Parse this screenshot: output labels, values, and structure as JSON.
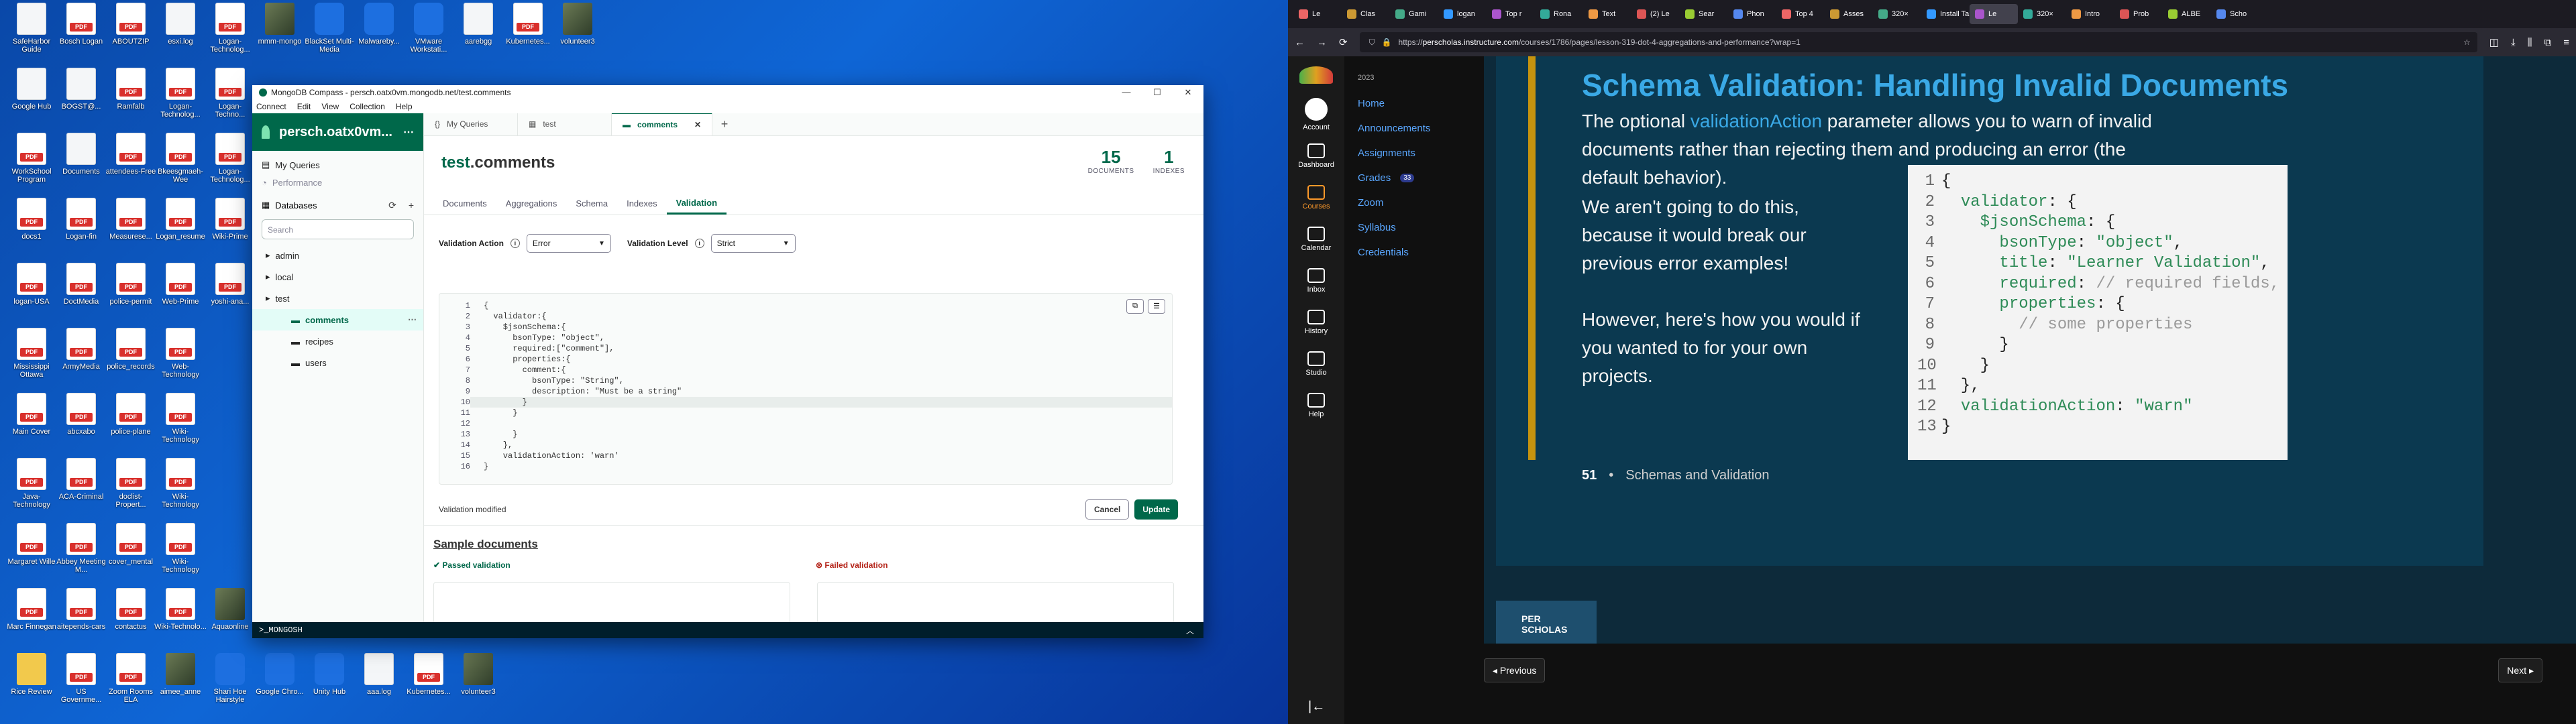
{
  "desktop": {
    "icons": [
      {
        "label": "SafeHarbor Guide",
        "kind": "doc",
        "col": 0,
        "row": 0
      },
      {
        "label": "Bosch Logan",
        "kind": "pdf",
        "col": 1,
        "row": 0
      },
      {
        "label": "ABOUTZIP",
        "kind": "pdf",
        "col": 2,
        "row": 0
      },
      {
        "label": "esxi.log",
        "kind": "doc",
        "col": 3,
        "row": 0
      },
      {
        "label": "Logan-Technolog...",
        "kind": "pdf",
        "col": 4,
        "row": 0
      },
      {
        "label": "mmm-mongo",
        "kind": "img",
        "col": 5,
        "row": 0
      },
      {
        "label": "BlackSet Multi-Media",
        "kind": "app",
        "col": 6,
        "row": 0
      },
      {
        "label": "Malwareby...",
        "kind": "app",
        "col": 7,
        "row": 0
      },
      {
        "label": "VMware Workstati...",
        "kind": "app",
        "col": 8,
        "row": 0
      },
      {
        "label": "aarebgg",
        "kind": "doc",
        "col": 9,
        "row": 0
      },
      {
        "label": "Kubernetes...",
        "kind": "pdf",
        "col": 10,
        "row": 0
      },
      {
        "label": "volunteer3",
        "kind": "img",
        "col": 11,
        "row": 0
      },
      {
        "label": "Google Hub",
        "kind": "doc",
        "col": 0,
        "row": 1
      },
      {
        "label": "BOGST@...",
        "kind": "doc",
        "col": 1,
        "row": 1
      },
      {
        "label": "Ramfalb",
        "kind": "pdf",
        "col": 2,
        "row": 1
      },
      {
        "label": "Logan-Technolog...",
        "kind": "pdf",
        "col": 3,
        "row": 1
      },
      {
        "label": "Logan-Techno...",
        "kind": "pdf",
        "col": 4,
        "row": 1
      },
      {
        "label": "WorkSchool Program",
        "kind": "pdf",
        "col": 0,
        "row": 2
      },
      {
        "label": "Documents",
        "kind": "doc",
        "col": 1,
        "row": 2
      },
      {
        "label": "attendees-Free",
        "kind": "pdf",
        "col": 2,
        "row": 2
      },
      {
        "label": "Bkeesgmaeh-Wee",
        "kind": "pdf",
        "col": 3,
        "row": 2
      },
      {
        "label": "Logan-Technolog...",
        "kind": "pdf",
        "col": 4,
        "row": 2
      },
      {
        "label": "docs1",
        "kind": "pdf",
        "col": 0,
        "row": 3
      },
      {
        "label": "Logan-fin",
        "kind": "pdf",
        "col": 1,
        "row": 3
      },
      {
        "label": "Measurese...",
        "kind": "pdf",
        "col": 2,
        "row": 3
      },
      {
        "label": "Logan_resume",
        "kind": "pdf",
        "col": 3,
        "row": 3
      },
      {
        "label": "Wiki-Prime",
        "kind": "pdf",
        "col": 4,
        "row": 3
      },
      {
        "label": "logan-USA",
        "kind": "pdf",
        "col": 0,
        "row": 4
      },
      {
        "label": "DoctMedia",
        "kind": "pdf",
        "col": 1,
        "row": 4
      },
      {
        "label": "police-permit",
        "kind": "pdf",
        "col": 2,
        "row": 4
      },
      {
        "label": "Web-Prime",
        "kind": "pdf",
        "col": 3,
        "row": 4
      },
      {
        "label": "yoshi-ana...",
        "kind": "pdf",
        "col": 4,
        "row": 4
      },
      {
        "label": "Mississippi Ottawa",
        "kind": "pdf",
        "col": 0,
        "row": 5
      },
      {
        "label": "ArmyMedia",
        "kind": "pdf",
        "col": 1,
        "row": 5
      },
      {
        "label": "police_records",
        "kind": "pdf",
        "col": 2,
        "row": 5
      },
      {
        "label": "Web-Technology",
        "kind": "pdf",
        "col": 3,
        "row": 5
      },
      {
        "label": "Main Cover",
        "kind": "pdf",
        "col": 0,
        "row": 6
      },
      {
        "label": "abcxabo",
        "kind": "pdf",
        "col": 1,
        "row": 6
      },
      {
        "label": "police-plane",
        "kind": "pdf",
        "col": 2,
        "row": 6
      },
      {
        "label": "Wiki-Technology",
        "kind": "pdf",
        "col": 3,
        "row": 6
      },
      {
        "label": "Java-Technology",
        "kind": "pdf",
        "col": 0,
        "row": 7
      },
      {
        "label": "ACA-Criminal",
        "kind": "pdf",
        "col": 1,
        "row": 7
      },
      {
        "label": "doclist-Propert...",
        "kind": "pdf",
        "col": 2,
        "row": 7
      },
      {
        "label": "Wiki-Technology",
        "kind": "pdf",
        "col": 3,
        "row": 7
      },
      {
        "label": "Margaret Wille",
        "kind": "pdf",
        "col": 0,
        "row": 8
      },
      {
        "label": "Abbey Meeting M...",
        "kind": "pdf",
        "col": 1,
        "row": 8
      },
      {
        "label": "cover_mental",
        "kind": "pdf",
        "col": 2,
        "row": 8
      },
      {
        "label": "Wiki-Technology",
        "kind": "pdf",
        "col": 3,
        "row": 8
      },
      {
        "label": "Marc Finnegan",
        "kind": "pdf",
        "col": 0,
        "row": 9
      },
      {
        "label": "aitepends-cars",
        "kind": "pdf",
        "col": 1,
        "row": 9
      },
      {
        "label": "contactus",
        "kind": "pdf",
        "col": 2,
        "row": 9
      },
      {
        "label": "Wiki-Technolo...",
        "kind": "pdf",
        "col": 3,
        "row": 9
      },
      {
        "label": "Aquaonline",
        "kind": "img",
        "col": 4,
        "row": 9
      },
      {
        "label": "Rice Review",
        "kind": "fold",
        "col": 0,
        "row": 10
      },
      {
        "label": "US Governme...",
        "kind": "pdf",
        "col": 1,
        "row": 10
      },
      {
        "label": "Zoom Rooms ELA",
        "kind": "pdf",
        "col": 2,
        "row": 10
      },
      {
        "label": "aimee_anne",
        "kind": "img",
        "col": 3,
        "row": 10
      },
      {
        "label": "Shari Hoe Hairstyle",
        "kind": "app",
        "col": 4,
        "row": 10
      },
      {
        "label": "Google Chro...",
        "kind": "app",
        "col": 5,
        "row": 10
      },
      {
        "label": "Unity Hub",
        "kind": "app",
        "col": 6,
        "row": 10
      },
      {
        "label": "aaa.log",
        "kind": "doc",
        "col": 7,
        "row": 10
      },
      {
        "label": "Kubernetes...",
        "kind": "pdf",
        "col": 8,
        "row": 10
      },
      {
        "label": "volunteer3",
        "kind": "img",
        "col": 9,
        "row": 10
      }
    ]
  },
  "compass": {
    "window_title": "MongoDB Compass - persch.oatx0vm.mongodb.net/test.comments",
    "menu": [
      "Connect",
      "Edit",
      "View",
      "Collection",
      "Help"
    ],
    "window_controls": [
      "—",
      "☐",
      "✕"
    ],
    "connection_name": "persch.oatx0vm...",
    "nav": {
      "my_queries": "My Queries",
      "performance": "Performance",
      "databases": "Databases"
    },
    "search_placeholder": "Search",
    "tree": [
      {
        "label": "admin",
        "level": 0,
        "selected": false
      },
      {
        "label": "local",
        "level": 0,
        "selected": false
      },
      {
        "label": "test",
        "level": 0,
        "selected": false
      },
      {
        "label": "comments",
        "level": 1,
        "selected": true
      },
      {
        "label": "recipes",
        "level": 1,
        "selected": false
      },
      {
        "label": "users",
        "level": 1,
        "selected": false
      }
    ],
    "tabs": [
      {
        "label": "My Queries"
      },
      {
        "label": "test"
      },
      {
        "label": "comments"
      }
    ],
    "namespace": {
      "db": "test",
      "coll": ".comments"
    },
    "stats": {
      "documents_value": "15",
      "documents_label": "DOCUMENTS",
      "indexes_value": "1",
      "indexes_label": "INDEXES"
    },
    "subtabs": [
      "Documents",
      "Aggregations",
      "Schema",
      "Indexes",
      "Validation"
    ],
    "active_subtab": "Validation",
    "validation_action_label": "Validation Action",
    "validation_action_value": "Error",
    "validation_level_label": "Validation Level",
    "validation_level_value": "Strict",
    "editor_lines": [
      "{",
      "  validator:{",
      "    $jsonSchema:{",
      "      bsonType: \"object\",",
      "      required:[\"comment\"],",
      "      properties:{",
      "        comment:{",
      "          bsonType: \"String\",",
      "          description: \"Must be a string\"",
      "        }",
      "      }",
      "",
      "      }",
      "    },",
      "    validationAction: 'warn'",
      "}"
    ],
    "status": "Validation modified",
    "cancel_label": "Cancel",
    "update_label": "Update",
    "sample_title": "Sample documents",
    "passed_label": "Passed validation",
    "failed_label": "Failed validation",
    "shell_label": ">_MONGOSH"
  },
  "browser": {
    "tabs": [
      "Le",
      "Clas",
      "Gami",
      "logan",
      "Top r",
      "Rona",
      "Text",
      "(2) Le",
      "Sear",
      "Phon",
      "Top 4",
      "Asses",
      "320×",
      "Install Tai",
      "Le",
      "320×",
      "Intro",
      "Prob",
      "ALBE",
      "Scho"
    ],
    "active_tab_index": 14,
    "url_prefix": "https://",
    "url_host": "perscholas.instructure.com",
    "url_path": "/courses/1786/pages/lesson-319-dot-4-aggregations-and-performance?wrap=1"
  },
  "canvas": {
    "global_nav": [
      "Account",
      "Dashboard",
      "Courses",
      "Calendar",
      "Inbox",
      "History",
      "Studio",
      "Help"
    ],
    "active_nav": "Courses",
    "inbox_badge": "1",
    "year": "2023",
    "course_nav": [
      {
        "label": "Home"
      },
      {
        "label": "Announcements"
      },
      {
        "label": "Assignments"
      },
      {
        "label": "Grades",
        "badge": "33"
      },
      {
        "label": "Zoom"
      },
      {
        "label": "Syllabus"
      },
      {
        "label": "Credentials"
      }
    ]
  },
  "slide": {
    "title": "Schema Validation: Handling Invalid Documents",
    "para1_a": "The optional ",
    "para1_link": "validationAction",
    "para1_b": " parameter allows you to warn of invalid documents rather than rejecting them and producing an error (the default behavior).",
    "para2": "We aren't going to do this, because it would break our previous error examples!",
    "para3": "However, here's how you would if you wanted to for your own projects.",
    "code_line_numbers": [
      "1",
      "2",
      "3",
      "4",
      "5",
      "6",
      "7",
      "8",
      "9",
      "10",
      "11",
      "12",
      "13"
    ],
    "slide_number": "51",
    "slide_section": "Schemas and Validation",
    "logo_text_1": "PER",
    "logo_text_2": "SCHOLAS",
    "prev_label": "◂ Previous",
    "next_label": "Next ▸"
  },
  "colors": {
    "mongo_green": "#00684a",
    "canvas_link": "#5aa7ff",
    "slide_title": "#3aa9e6",
    "slide_gold": "#c6930e"
  }
}
